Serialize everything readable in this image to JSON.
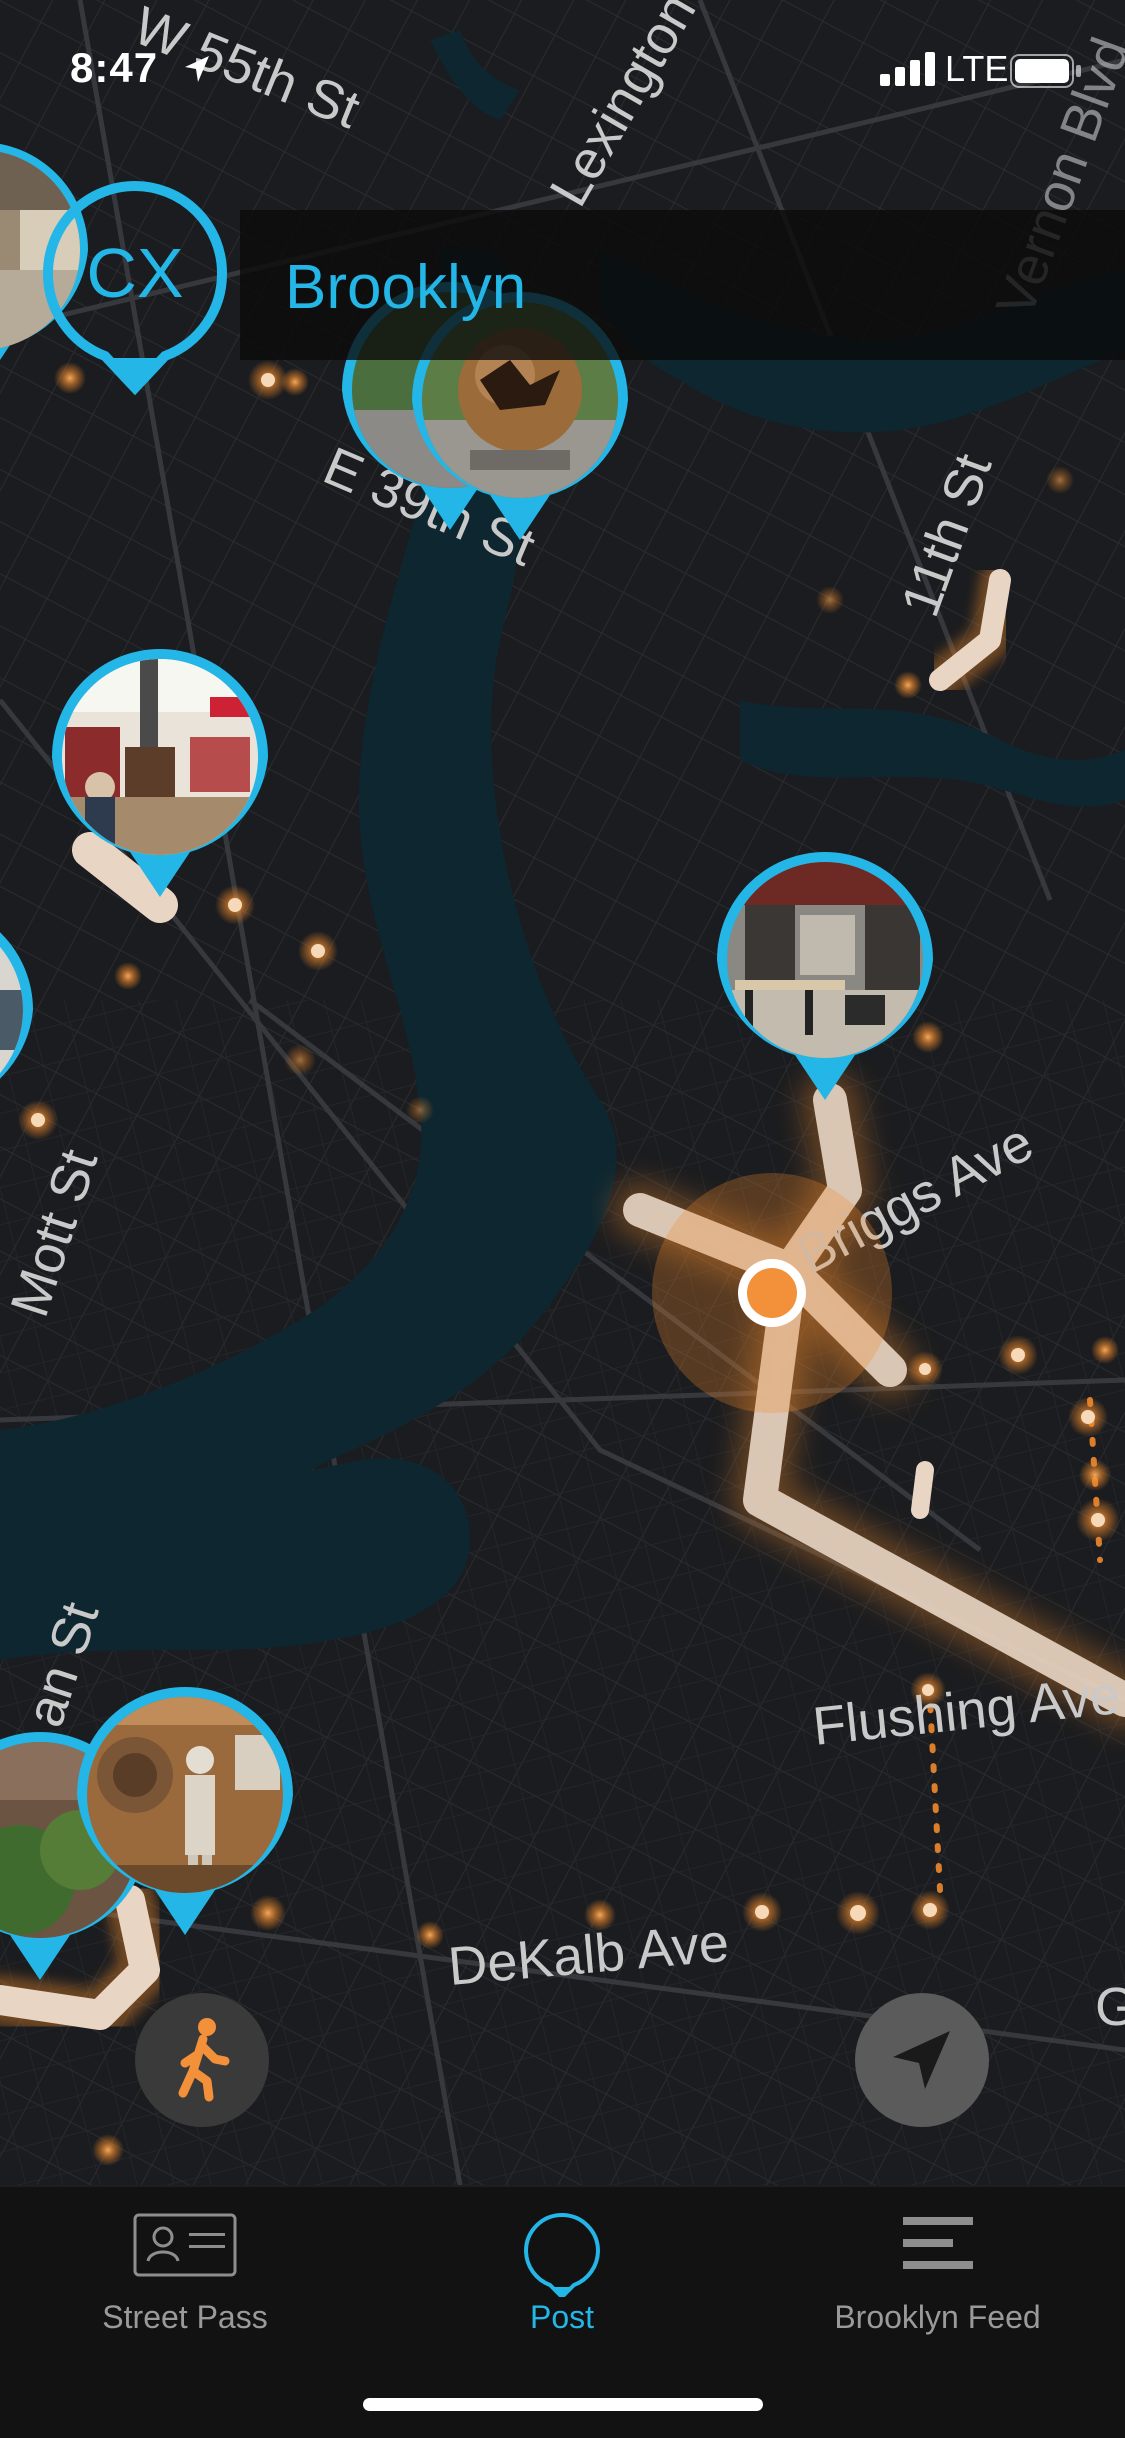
{
  "status_bar": {
    "time": "8:47",
    "carrier": "LTE"
  },
  "header": {
    "logo_text": "CX",
    "title": "Brooklyn"
  },
  "map": {
    "street_labels": [
      "W 55th St",
      "Lexington",
      "Vernon Blvd",
      "E 39th St",
      "11th St",
      "Mott St",
      "Briggs Ave",
      "an St",
      "Flushing Ave",
      "DeKalb Ave",
      "G"
    ],
    "photo_pins": [
      {
        "name": "pin-midtown-lobby",
        "theme": "lobby"
      },
      {
        "name": "pin-sphere-sculpture",
        "theme": "sculpture"
      },
      {
        "name": "pin-bookstore",
        "theme": "bookstore"
      },
      {
        "name": "pin-gallery",
        "theme": "gallery"
      },
      {
        "name": "pin-left-edge",
        "theme": "room"
      },
      {
        "name": "pin-garden",
        "theme": "garden"
      },
      {
        "name": "pin-museum-statue",
        "theme": "museum"
      }
    ],
    "colors": {
      "water": "#0d2630",
      "land": "#1b1c1f",
      "pin_ring": "#23b6e6",
      "trail": "#f08a2c",
      "user_dot": "#f2913a"
    }
  },
  "controls": {
    "walk_icon": "walking-person-icon",
    "locate_icon": "location-arrow-icon"
  },
  "tabs": [
    {
      "label": "Street Pass",
      "icon": "id-card-icon",
      "active": false
    },
    {
      "label": "Post",
      "icon": "pin-outline-icon",
      "active": true
    },
    {
      "label": "Brooklyn Feed",
      "icon": "menu-lines-icon",
      "active": false
    }
  ]
}
